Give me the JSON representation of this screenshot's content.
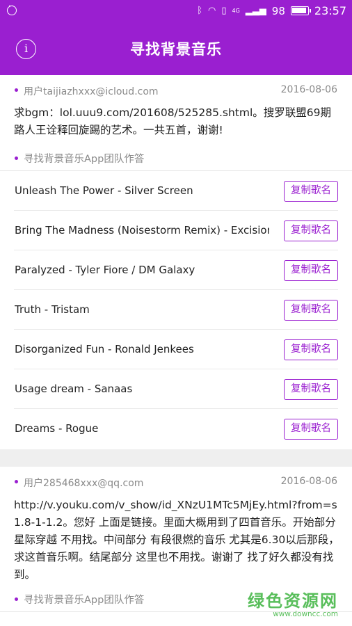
{
  "status_bar": {
    "battery": "98",
    "time": "23:57",
    "network": "4G"
  },
  "header": {
    "title": "寻找背景音乐",
    "info_glyph": "i"
  },
  "posts": [
    {
      "user": "用户taijiazhxxx@icloud.com",
      "date": "2016-08-06",
      "question": "求bgm：lol.uuu9.com/201608/525285.shtml。搜罗联盟69期 路人王诠释回旋踢的艺术。一共五首，谢谢!",
      "answer_header": "寻找背景音乐App团队作答",
      "copy_label": "复制歌名",
      "songs": [
        "Unleash The Power - Silver Screen",
        "Bring The Madness (Noisestorm Remix) - Excision / Pegboard Nerds",
        "Paralyzed - Tyler Fiore / DM Galaxy",
        "Truth - Tristam",
        "Disorganized Fun - Ronald Jenkees",
        "Usage dream - Sanaas",
        "Dreams - Rogue"
      ]
    },
    {
      "user": "用户285468xxx@qq.com",
      "date": "2016-08-06",
      "question": "http://v.youku.com/v_show/id_XNzU1MTc5MjEy.html?from=s1.8-1-1.2。您好 上面是链接。里面大概用到了四首音乐。开始部分 星际穿越 不用找。中间部分 有段很燃的音乐 尤其是6.30以后那段，求这首音乐啊。结尾部分 这里也不用找。谢谢了 找了好久都没有找到。",
      "answer_header": "寻找背景音乐App团队作答"
    }
  ],
  "watermark": {
    "main": "绿色资源网",
    "sub": "www.downcc.com"
  }
}
